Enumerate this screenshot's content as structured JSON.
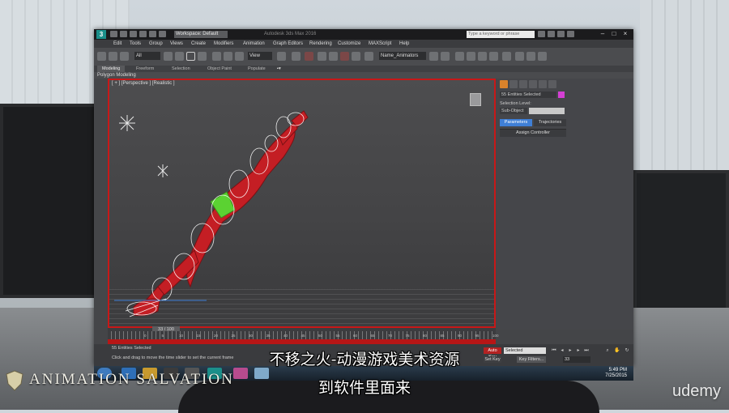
{
  "titlebar": {
    "workspace": "Workspace: Default",
    "title": "Autodesk 3ds Max 2016",
    "search_placeholder": "Type a keyword or phrase"
  },
  "menu": [
    "Edit",
    "Tools",
    "Group",
    "Views",
    "Create",
    "Modifiers",
    "Animation",
    "Graph Editors",
    "Rendering",
    "Customize",
    "MAXScript",
    "Help"
  ],
  "toolbar": {
    "filter": "All",
    "coord": "View",
    "named_selection": "Name_Animators"
  },
  "ribbon_tabs": [
    "Modeling",
    "Freeform",
    "Selection",
    "Object Paint",
    "Populate"
  ],
  "ribbon_active": "Modeling",
  "ribbon_panel": "Polygon Modeling",
  "viewport": {
    "label": "[ + ] [Perspective ] [Realistic ]"
  },
  "command_panel": {
    "selection_info": "55 Entities Selected",
    "selection_level": "Selection Level:",
    "sub_object": "Sub-Object",
    "tab_parameters": "Parameters",
    "tab_trajectories": "Trajectories",
    "assign_controller": "Assign Controller"
  },
  "timeline": {
    "frame_display": "33 / 100",
    "ticks": [
      "0",
      "5",
      "10",
      "15",
      "20",
      "25",
      "30",
      "35",
      "40",
      "45",
      "50",
      "55",
      "60",
      "65",
      "70",
      "75",
      "80",
      "85",
      "90",
      "95",
      "100"
    ]
  },
  "status": {
    "entities": "55 Entities Selected",
    "hint": "Click and drag to move the time slider to set the current frame",
    "auto_key": "Auto Key",
    "set_key": "Set Key",
    "selected": "Selected",
    "key_filters": "Key Filters...",
    "frame_field": "33"
  },
  "taskbar": {
    "time": "5:49 PM",
    "date": "7/25/2015"
  },
  "overlay": {
    "brand": "ANIMATION SALVATION",
    "watermark": "udemy",
    "subtitle_line1": "不移之火-动漫游戏美术资源",
    "subtitle_line2": "到软件里面来"
  },
  "colors": {
    "viewport_border": "#c81818",
    "timeline_track": "#b71616",
    "auto_key": "#b32222",
    "character_body": "#c41e24",
    "character_belt": "#5bd232",
    "accent_blue": "#3f7fd6"
  }
}
